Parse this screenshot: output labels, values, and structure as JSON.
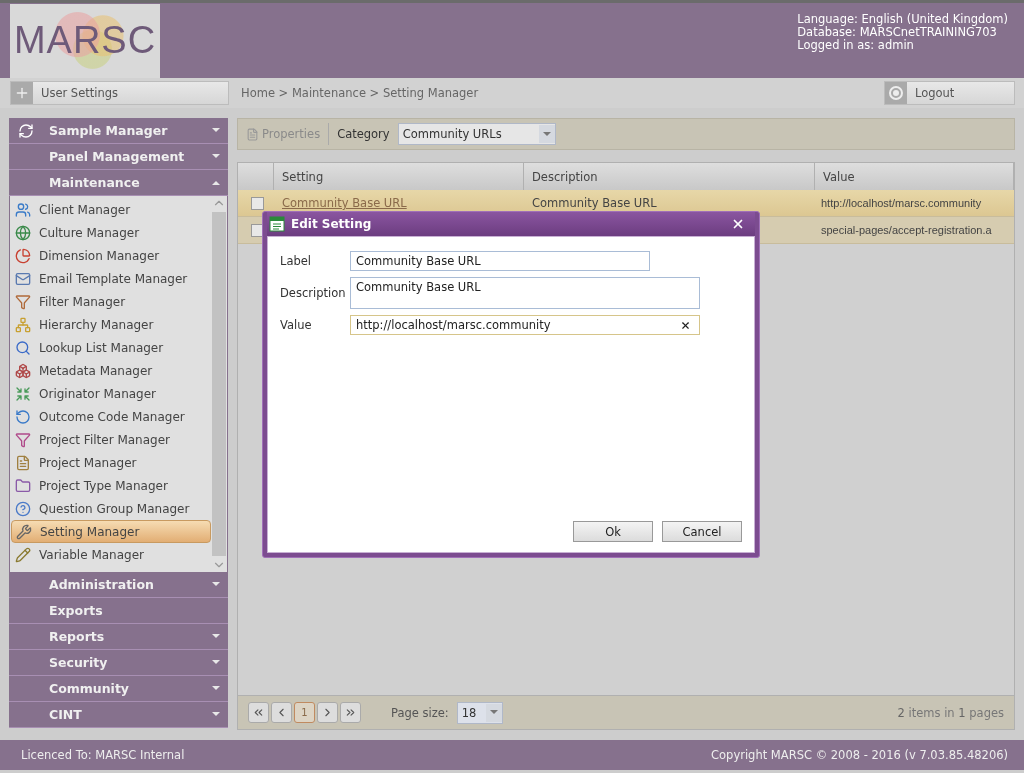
{
  "header": {
    "logo": "MARSC",
    "info": [
      "Language: English (United Kingdom)",
      "Database: MARSCnetTRAINING703",
      "Logged in as: admin"
    ]
  },
  "toolbar": {
    "user_settings": "User Settings",
    "breadcrumb": "Home > Maintenance > Setting Manager",
    "logout": "Logout"
  },
  "sidebar": {
    "sections": [
      {
        "label": "Sample Manager",
        "has_icon": true,
        "collapsible": true,
        "expanded": false
      },
      {
        "label": "Panel Management",
        "has_icon": false,
        "collapsible": true,
        "expanded": false
      },
      {
        "label": "Maintenance",
        "has_icon": false,
        "collapsible": true,
        "expanded": true,
        "children": [
          {
            "label": "Client Manager",
            "selected": false
          },
          {
            "label": "Culture Manager",
            "selected": false
          },
          {
            "label": "Dimension Manager",
            "selected": false
          },
          {
            "label": "Email Template Manager",
            "selected": false
          },
          {
            "label": "Filter Manager",
            "selected": false
          },
          {
            "label": "Hierarchy Manager",
            "selected": false
          },
          {
            "label": "Lookup List Manager",
            "selected": false
          },
          {
            "label": "Metadata Manager",
            "selected": false
          },
          {
            "label": "Originator Manager",
            "selected": false
          },
          {
            "label": "Outcome Code Manager",
            "selected": false
          },
          {
            "label": "Project Filter Manager",
            "selected": false
          },
          {
            "label": "Project Manager",
            "selected": false
          },
          {
            "label": "Project Type Manager",
            "selected": false
          },
          {
            "label": "Question Group Manager",
            "selected": false
          },
          {
            "label": "Setting Manager",
            "selected": true
          },
          {
            "label": "Variable Manager",
            "selected": false
          }
        ]
      },
      {
        "label": "Administration",
        "has_icon": false,
        "collapsible": true,
        "expanded": false
      },
      {
        "label": "Exports",
        "has_icon": false,
        "collapsible": false
      },
      {
        "label": "Reports",
        "has_icon": false,
        "collapsible": true,
        "expanded": false
      },
      {
        "label": "Security",
        "has_icon": false,
        "collapsible": true,
        "expanded": false
      },
      {
        "label": "Community",
        "has_icon": false,
        "collapsible": true,
        "expanded": false
      },
      {
        "label": "CINT",
        "has_icon": false,
        "collapsible": true,
        "expanded": false
      }
    ]
  },
  "main_toolbar": {
    "properties": "Properties",
    "properties_disabled": true,
    "category_label": "Category",
    "category_value": "Community URLs"
  },
  "table": {
    "columns": [
      "Setting",
      "Description",
      "Value"
    ],
    "rows": [
      {
        "setting": "Community Base URL",
        "description": "Community Base URL",
        "value": "http://localhost/marsc.community",
        "selected": true,
        "checked": false
      },
      {
        "value": "special-pages/accept-registration.a",
        "selected": false,
        "checked": false
      }
    ]
  },
  "pager": {
    "pages": [
      {
        "label": "1",
        "selected": true
      }
    ],
    "page_size_label": "Page size:",
    "page_size": "18",
    "summary": "**2** items in **1** pages"
  },
  "dialog": {
    "title": "Edit Setting",
    "fields": [
      {
        "kind": "text",
        "label": "Label",
        "value": "Community Base URL",
        "focused": false
      },
      {
        "kind": "textarea",
        "label": "Description",
        "value": "Community Base URL",
        "focused": false
      },
      {
        "kind": "clearable",
        "label": "Value",
        "value": "http://localhost/marsc.community",
        "focused": true
      }
    ],
    "buttons": [
      "Ok",
      "Cancel"
    ]
  },
  "footer": {
    "licence": "Licenced To: MARSC Internal",
    "copyright": "Copyright MARSC © 2008 - 2016  (v 7.03.85.48206)"
  }
}
